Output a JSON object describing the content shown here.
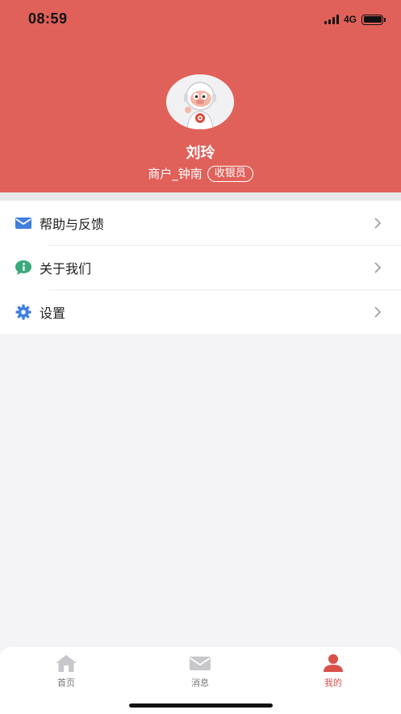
{
  "status_bar": {
    "time": "08:59",
    "network": "4G",
    "icons": [
      "signal-icon",
      "battery-icon"
    ]
  },
  "profile": {
    "name": "刘玲",
    "merchant": "商户_钟南",
    "role": "收银员",
    "avatar": "mascot-avatar"
  },
  "menu": [
    {
      "label": "帮助与反馈",
      "icon": "mail-icon",
      "icon_color": "#3f7fe0"
    },
    {
      "label": "关于我们",
      "icon": "info-icon",
      "icon_color": "#3aaa7a"
    },
    {
      "label": "设置",
      "icon": "gear-icon",
      "icon_color": "#3f7fe0"
    }
  ],
  "tabbar": [
    {
      "label": "首页",
      "icon": "home-icon",
      "active": false
    },
    {
      "label": "消息",
      "icon": "message-icon",
      "active": false
    },
    {
      "label": "我的",
      "icon": "profile-icon",
      "active": true
    }
  ],
  "colors": {
    "header_bg": "#e0615a",
    "active_tab": "#d9514b",
    "inactive_icon": "#c8c8cc",
    "page_bg": "#f4f4f6"
  }
}
